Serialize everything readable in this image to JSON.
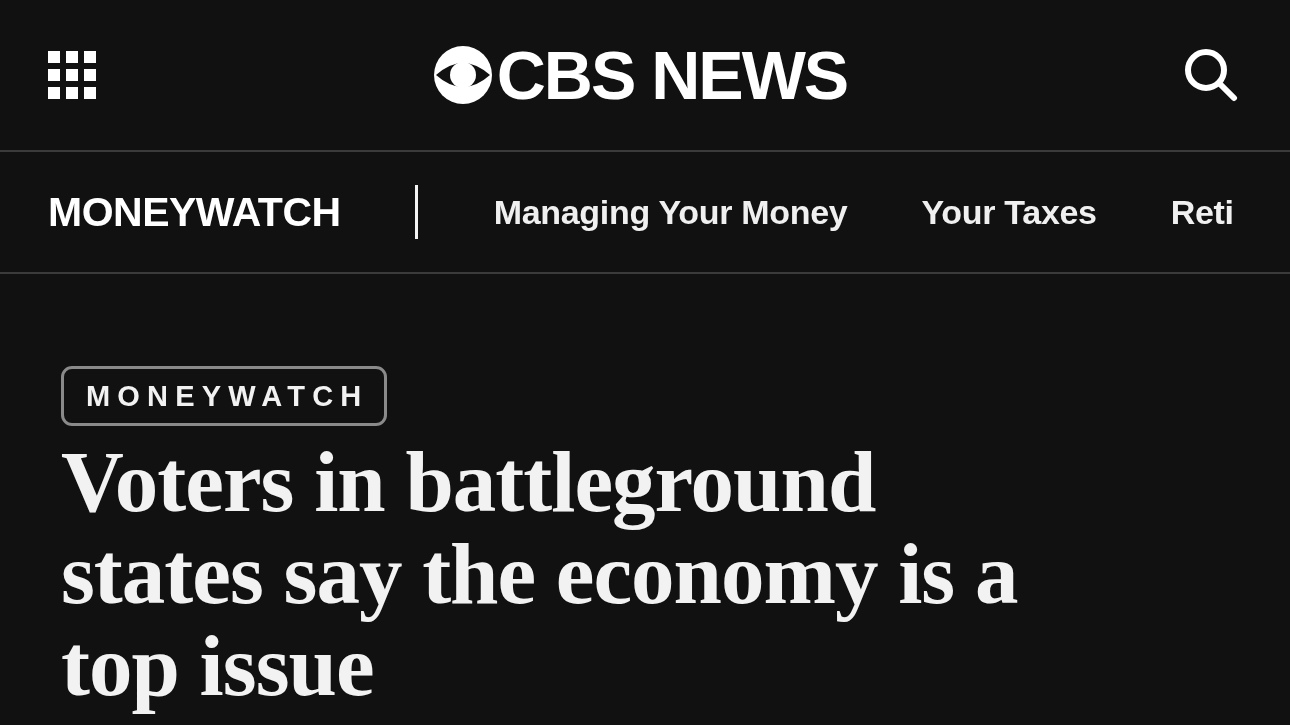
{
  "header": {
    "logo": "CBS NEWS"
  },
  "section_nav": {
    "title": "MONEYWATCH",
    "links": [
      "Managing Your Money",
      "Your Taxes",
      "Reti"
    ]
  },
  "article": {
    "tag": "MONEYWATCH",
    "headline": "Voters in battleground states say the economy is a top issue"
  }
}
